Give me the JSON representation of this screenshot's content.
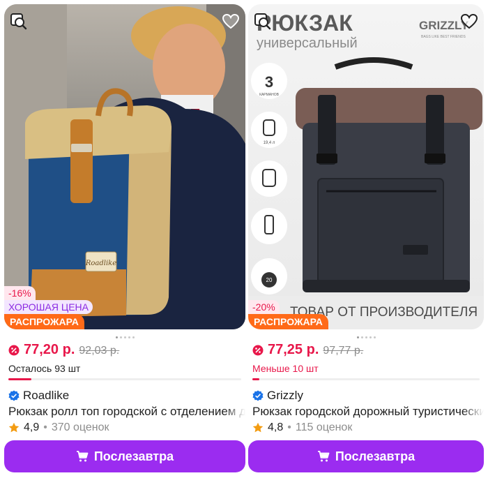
{
  "products": [
    {
      "discount_badge": "-16%",
      "good_price_badge": "ХОРОШАЯ ЦЕНА",
      "sale_badge": "РАСПРОЖАРА",
      "price": "77,20 р.",
      "old_price": "92,03 р.",
      "stock_text": "Осталось 93 шт",
      "stock_level": 0.1,
      "seller": "Roadlike",
      "title": "Рюкзак ролл топ городской с отделением для ноутбука",
      "rating": "4,9",
      "reviews": "370 оценок",
      "cta_label": "Послезавтра",
      "image_label": "Roadlike"
    },
    {
      "discount_badge": "-20%",
      "sale_badge": "РАСПРОЖАРА",
      "price": "77,25 р.",
      "old_price": "97,77 р.",
      "stock_text": "Меньше 10 шт",
      "stock_level": 0.03,
      "seller": "Grizzly",
      "title": "Рюкзак городской дорожный туристический",
      "rating": "4,8",
      "reviews": "115 оценок",
      "cta_label": "Послезавтра",
      "image_heading": "РЮКЗАК",
      "image_subheading": "универсальный",
      "image_brand": "GRIZZLY",
      "image_brand_tagline": "BAGS LIKE BEST FRIENDS",
      "image_banner": "ТОВАР ОТ ПРОИЗВОДИТЕЛЯ",
      "features": [
        "3",
        "КАРМАНОВ",
        "19,4 л",
        "20"
      ]
    }
  ],
  "colors": {
    "accent": "#9b2cf0",
    "price": "#e8174a",
    "sale": "#ff6a18"
  }
}
